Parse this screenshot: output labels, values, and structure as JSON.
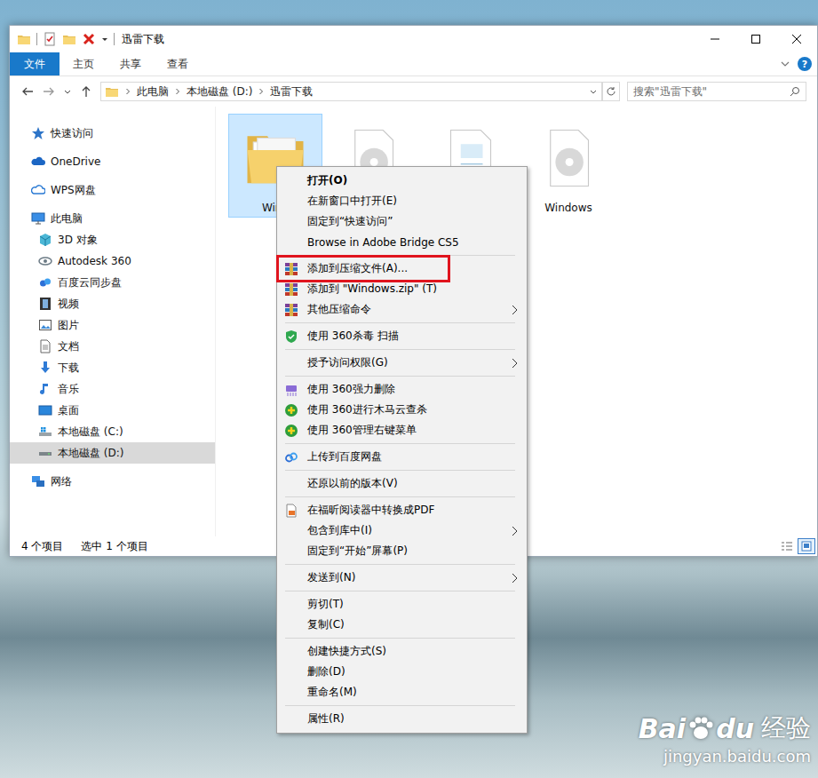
{
  "window": {
    "title": "迅雷下载"
  },
  "ribbon": {
    "tabs": [
      {
        "label": "文件",
        "selected": true
      },
      {
        "label": "主页",
        "selected": false
      },
      {
        "label": "共享",
        "selected": false
      },
      {
        "label": "查看",
        "selected": false
      }
    ],
    "help": "?"
  },
  "address": {
    "path": [
      "此电脑",
      "本地磁盘 (D:)",
      "迅雷下载"
    ],
    "search_placeholder": "搜索\"迅雷下载\""
  },
  "sidebar": [
    {
      "label": "快速访问",
      "kind": "quick",
      "selected": false
    },
    {
      "label": "OneDrive",
      "kind": "onedrive",
      "selected": false
    },
    {
      "label": "WPS网盘",
      "kind": "wps",
      "selected": false
    },
    {
      "label": "此电脑",
      "kind": "pc",
      "selected": false
    },
    {
      "label": "3D 对象",
      "kind": "obj3d",
      "selected": false
    },
    {
      "label": "Autodesk 360",
      "kind": "autodesk",
      "selected": false
    },
    {
      "label": "百度云同步盘",
      "kind": "baiduyun",
      "selected": false
    },
    {
      "label": "视频",
      "kind": "video",
      "selected": false
    },
    {
      "label": "图片",
      "kind": "pictures",
      "selected": false
    },
    {
      "label": "文档",
      "kind": "docs",
      "selected": false
    },
    {
      "label": "下载",
      "kind": "downloads",
      "selected": false
    },
    {
      "label": "音乐",
      "kind": "music",
      "selected": false
    },
    {
      "label": "桌面",
      "kind": "desktop",
      "selected": false
    },
    {
      "label": "本地磁盘 (C:)",
      "kind": "drive_c",
      "selected": false
    },
    {
      "label": "本地磁盘 (D:)",
      "kind": "drive_d",
      "selected": true
    },
    {
      "label": "网络",
      "kind": "network",
      "selected": false
    }
  ],
  "files": [
    {
      "name": "Wind",
      "kind": "folder",
      "selected": true
    },
    {
      "name": "",
      "kind": "disc",
      "selected": false
    },
    {
      "name": "",
      "kind": "document",
      "selected": false
    },
    {
      "name": "Windows",
      "kind": "disc",
      "selected": false
    }
  ],
  "status_bar": {
    "count": "4 个项目",
    "selection": "选中 1 个项目",
    "views": [
      {
        "kind": "details",
        "selected": false
      },
      {
        "kind": "large_icons",
        "selected": true
      }
    ]
  },
  "context_menu": {
    "groups": [
      [
        {
          "label": "打开(O)",
          "kind": "plain",
          "default": true,
          "submenu": false,
          "highlighted": false
        },
        {
          "label": "在新窗口中打开(E)",
          "kind": "plain",
          "default": false,
          "submenu": false,
          "highlighted": false
        },
        {
          "label": "固定到“快速访问”",
          "kind": "plain",
          "default": false,
          "submenu": false,
          "highlighted": false
        },
        {
          "label": "Browse in Adobe Bridge CS5",
          "kind": "plain",
          "default": false,
          "submenu": false,
          "highlighted": false
        }
      ],
      [
        {
          "label": "添加到压缩文件(A)...",
          "kind": "archive",
          "default": false,
          "submenu": false,
          "highlighted": true
        },
        {
          "label": "添加到 \"Windows.zip\" (T)",
          "kind": "archive",
          "default": false,
          "submenu": false,
          "highlighted": false
        },
        {
          "label": "其他压缩命令",
          "kind": "archive",
          "default": false,
          "submenu": true,
          "highlighted": false
        }
      ],
      [
        {
          "label": "使用 360杀毒 扫描",
          "kind": "antivirus",
          "default": false,
          "submenu": false,
          "highlighted": false
        }
      ],
      [
        {
          "label": "授予访问权限(G)",
          "kind": "plain",
          "default": false,
          "submenu": true,
          "highlighted": false
        }
      ],
      [
        {
          "label": "使用 360强力删除",
          "kind": "shred",
          "default": false,
          "submenu": false,
          "highlighted": false
        },
        {
          "label": "使用 360进行木马云查杀",
          "kind": "trojan",
          "default": false,
          "submenu": false,
          "highlighted": false
        },
        {
          "label": "使用 360管理右键菜单",
          "kind": "trojan",
          "default": false,
          "submenu": false,
          "highlighted": false
        }
      ],
      [
        {
          "label": "上传到百度网盘",
          "kind": "cloud",
          "default": false,
          "submenu": false,
          "highlighted": false
        }
      ],
      [
        {
          "label": "还原以前的版本(V)",
          "kind": "plain",
          "default": false,
          "submenu": false,
          "highlighted": false
        }
      ],
      [
        {
          "label": "在福昕阅读器中转换成PDF",
          "kind": "pdf",
          "default": false,
          "submenu": false,
          "highlighted": false
        },
        {
          "label": "包含到库中(I)",
          "kind": "plain",
          "default": false,
          "submenu": true,
          "highlighted": false
        },
        {
          "label": "固定到“开始”屏幕(P)",
          "kind": "plain",
          "default": false,
          "submenu": false,
          "highlighted": false
        }
      ],
      [
        {
          "label": "发送到(N)",
          "kind": "plain",
          "default": false,
          "submenu": true,
          "highlighted": false
        }
      ],
      [
        {
          "label": "剪切(T)",
          "kind": "plain",
          "default": false,
          "submenu": false,
          "highlighted": false
        },
        {
          "label": "复制(C)",
          "kind": "plain",
          "default": false,
          "submenu": false,
          "highlighted": false
        }
      ],
      [
        {
          "label": "创建快捷方式(S)",
          "kind": "plain",
          "default": false,
          "submenu": false,
          "highlighted": false
        },
        {
          "label": "删除(D)",
          "kind": "plain",
          "default": false,
          "submenu": false,
          "highlighted": false
        },
        {
          "label": "重命名(M)",
          "kind": "plain",
          "default": false,
          "submenu": false,
          "highlighted": false
        }
      ],
      [
        {
          "label": "属性(R)",
          "kind": "plain",
          "default": false,
          "submenu": false,
          "highlighted": false
        }
      ]
    ]
  },
  "watermark": {
    "brand_left": "Bai",
    "brand_right": "du",
    "brand_cn": "经验",
    "url": "jingyan.baidu.com"
  }
}
